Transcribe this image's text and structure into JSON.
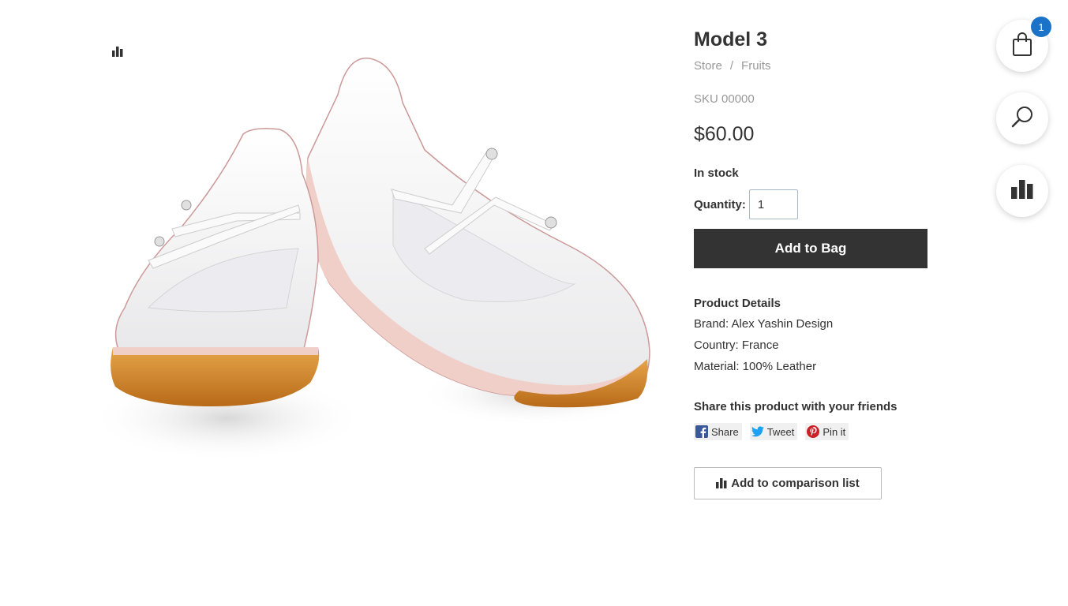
{
  "product": {
    "title": "Model 3",
    "breadcrumb": [
      "Store",
      "Fruits"
    ],
    "breadcrumb_separator": "/",
    "sku": "SKU 00000",
    "price": "$60.00",
    "stock": "In stock",
    "quantity_label": "Quantity:",
    "quantity_value": "1",
    "add_to_bag": "Add to Bag"
  },
  "details": {
    "heading": "Product Details",
    "brand": "Brand: Alex Yashin Design",
    "country": "Country: France",
    "material": "Material: 100% Leather"
  },
  "share": {
    "heading": "Share this product with your friends",
    "facebook": "Share",
    "twitter": "Tweet",
    "pinterest": "Pin it"
  },
  "compare": {
    "label": "Add to comparison list"
  },
  "floating": {
    "bag_count": "1"
  },
  "colors": {
    "primary_dark": "#333333",
    "badge_blue": "#1a73c9",
    "facebook": "#3b5998",
    "twitter": "#1da1f2",
    "pinterest": "#cb2027"
  },
  "icons": [
    "compare-icon",
    "shopping-bag-icon",
    "search-icon",
    "facebook-icon",
    "twitter-icon",
    "pinterest-icon"
  ]
}
